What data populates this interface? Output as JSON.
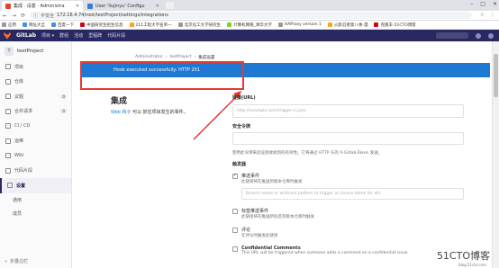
{
  "browser": {
    "tabs": [
      {
        "label": "集成 · 设置 · Administra",
        "active": true
      },
      {
        "label": "User 'liujinyu' Configu",
        "active": false
      }
    ],
    "secure_label": "不安全",
    "url": "172.16.4.74/root/testProject/settings/integrations",
    "bookmarks": [
      "应用",
      "网址大全",
      "百度一下",
      "中国研究生招生信息",
      "211工程大学名单一",
      "北京化工大学研究生",
      "计算机网络_清华大学",
      "HAProxy version 1",
      "火影忍者第八季-漫",
      "克隆羊-51CTO博客"
    ]
  },
  "gitlab": {
    "brand": "GitLab",
    "nav": [
      "项目 ▾",
      "群组",
      "活动",
      "里程碑",
      "代码片段"
    ]
  },
  "sidebar": {
    "project_initial": "T",
    "project_name": "testProject",
    "items": [
      {
        "label": "项目",
        "icon": "home-icon",
        "count": ""
      },
      {
        "label": "仓库",
        "icon": "book-icon",
        "count": ""
      },
      {
        "label": "议题",
        "icon": "issues-icon",
        "count": "0"
      },
      {
        "label": "合并请求",
        "icon": "merge-request-icon",
        "count": "0"
      },
      {
        "label": "CI / CD",
        "icon": "rocket-icon",
        "count": ""
      },
      {
        "label": "运维",
        "icon": "cloud-icon",
        "count": ""
      },
      {
        "label": "Wiki",
        "icon": "book-open-icon",
        "count": ""
      },
      {
        "label": "代码片段",
        "icon": "snippet-icon",
        "count": ""
      },
      {
        "label": "设置",
        "icon": "gear-icon",
        "count": ""
      }
    ],
    "sub_items": [
      "通用",
      "成员"
    ],
    "collapse_label": "折叠边栏"
  },
  "breadcrumb": [
    "Administrator",
    "testProject",
    "集成设置"
  ],
  "banner_text": "Hook executed successfully: HTTP 201",
  "section": {
    "title": "集成",
    "desc_link": "Web 钩子",
    "desc_rest": " 可以 抓住项目发生的事件。"
  },
  "form": {
    "url_label": "链接(URL)",
    "url_placeholder": "http://example.com/trigger-ci.json",
    "token_label": "安全令牌",
    "token_help": "使用此令牌来验证接收收到的有效性。它将通过 HTTP 头的 X-Gitlab-Token 发送。",
    "trigger_label": "触发器",
    "triggers": [
      {
        "label": "推送事件",
        "help": "此链接将在推送到版本仓库时触发",
        "checked": true,
        "bold": false
      },
      {
        "label": "标签推送事件",
        "help": "此链接将在推送新标签到版本仓库时触发",
        "checked": false,
        "bold": false
      },
      {
        "label": "评论",
        "help": "在评论时触发此链接",
        "checked": false,
        "bold": false
      },
      {
        "label": "Confidential Comments",
        "help": "This URL will be triggered when someone adds a comment on a confidential issue",
        "checked": false,
        "bold": true
      }
    ],
    "branch_placeholder": "Branch name or wildcard pattern to trigger on (leave blank for all)"
  },
  "watermark": {
    "text": "51CTO博客",
    "sub": "blog.51cto.com"
  }
}
